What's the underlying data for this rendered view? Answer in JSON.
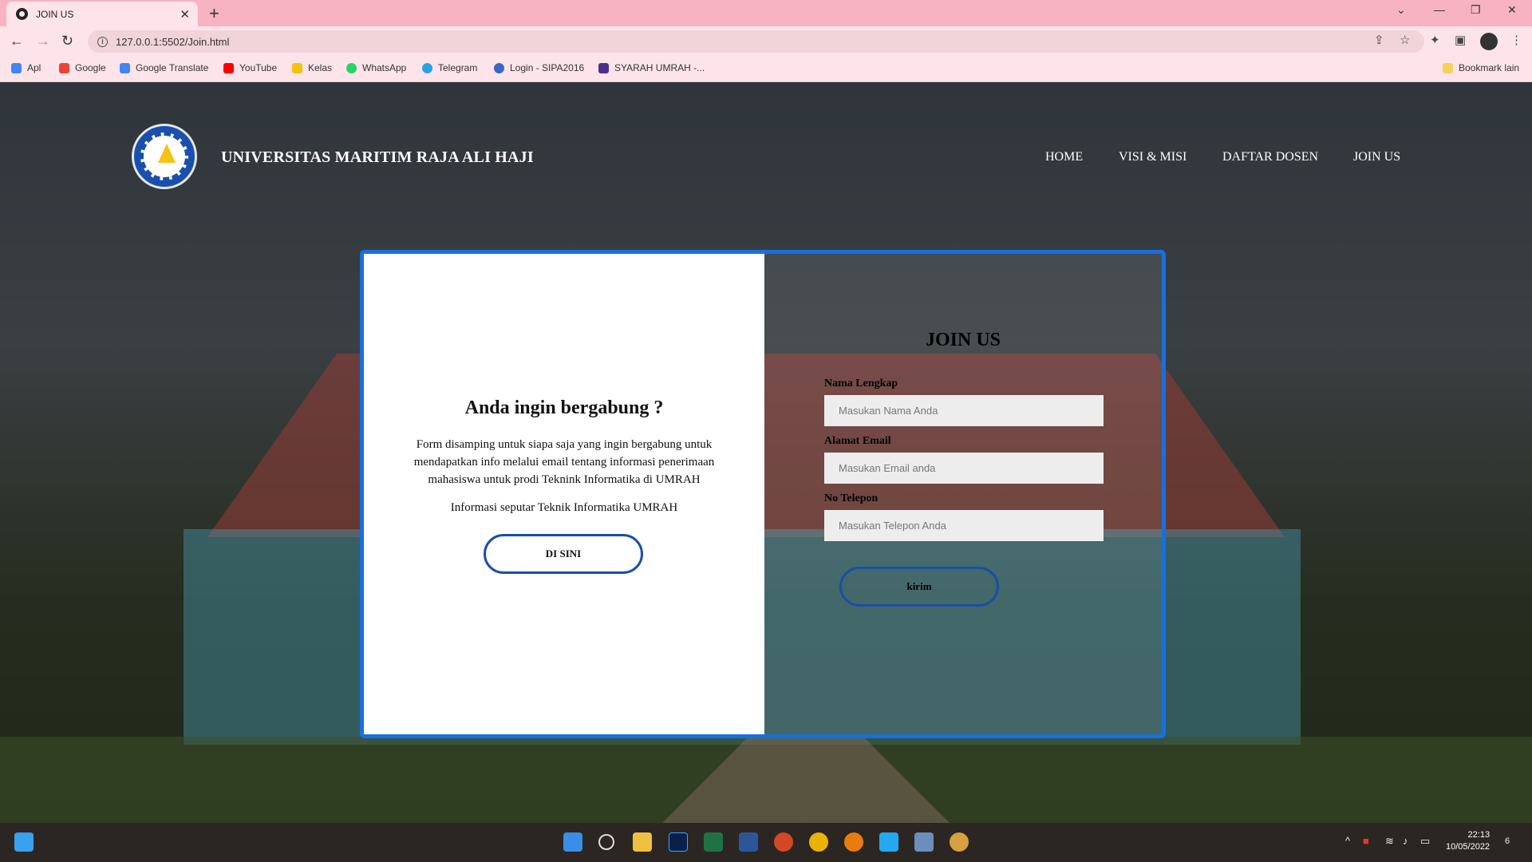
{
  "browser": {
    "tab_title": "JOIN US",
    "tab_close": "✕",
    "new_tab": "+",
    "url": "127.0.0.1:5502/Join.html",
    "window_controls": [
      "⌄",
      "—",
      "❐",
      "✕"
    ],
    "bookmarks": [
      {
        "label": "Apl",
        "color": "#4285f4"
      },
      {
        "label": "Google",
        "color": "#ea4335"
      },
      {
        "label": "Google Translate",
        "color": "#4285f4"
      },
      {
        "label": "YouTube",
        "color": "#ff0000"
      },
      {
        "label": "Kelas",
        "color": "#f4c20d"
      },
      {
        "label": "WhatsApp",
        "color": "#25d366"
      },
      {
        "label": "Telegram",
        "color": "#2aa3e0"
      },
      {
        "label": "Login - SIPA2016",
        "color": "#3a66c4"
      },
      {
        "label": "SYARAH UMRAH -...",
        "color": "#4b2f8f"
      }
    ],
    "other_bookmarks": "Bookmark lain"
  },
  "site": {
    "university": "UNIVERSITAS MARITIM RAJA ALI HAJI",
    "nav": [
      "HOME",
      "VISI & MISI",
      "DAFTAR DOSEN",
      "JOIN US"
    ]
  },
  "left_panel": {
    "heading": "Anda ingin bergabung ?",
    "description": "Form disamping untuk siapa saja yang ingin bergabung untuk mendapatkan info melalui email tentang informasi penerimaan mahasiswa untuk prodi Teknink Informatika di UMRAH",
    "info": "Informasi seputar Teknik Informatika UMRAH",
    "button": "DI SINI"
  },
  "form": {
    "heading": "JOIN US",
    "fields": [
      {
        "label": "Nama Lengkap",
        "placeholder": "Masukan Nama Anda"
      },
      {
        "label": "Alamat Email",
        "placeholder": "Masukan Email anda"
      },
      {
        "label": "No Telepon",
        "placeholder": "Masukan Telepon Anda"
      }
    ],
    "submit": "kirim"
  },
  "taskbar": {
    "time": "22:13",
    "date": "10/05/2022",
    "notification_count": "6"
  },
  "colors": {
    "accent_blue": "#1670e0",
    "button_border": "#1b4ea6",
    "tab_bar": "#f7b3c1"
  }
}
